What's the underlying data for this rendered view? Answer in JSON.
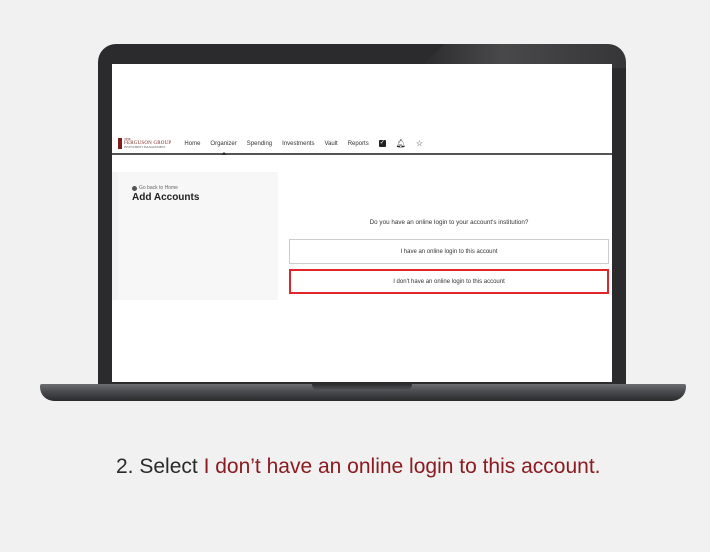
{
  "colors": {
    "page_background": "#f1f1f1",
    "accent": "#8b1b20",
    "highlight_border": "#e0262a",
    "laptop_frame": "#2b2b2d"
  },
  "app": {
    "logo": {
      "line1": "THE",
      "line2": "FERGUSON GROUP",
      "line3": "INVESTMENT MANAGEMENT"
    },
    "nav": {
      "items": [
        {
          "label": "Home"
        },
        {
          "label": "Organizer",
          "active": true
        },
        {
          "label": "Spending"
        },
        {
          "label": "Investments"
        },
        {
          "label": "Vault"
        },
        {
          "label": "Reports"
        }
      ],
      "icons": [
        "checkbox-icon",
        "bell-icon",
        "star-icon"
      ]
    },
    "back_link": "Go back to Home",
    "page_title": "Add Accounts",
    "question": "Do you have an online login to your account's institution?",
    "options": [
      {
        "label": "I have an online login to this account",
        "highlighted": false
      },
      {
        "label": "I don't have an online login to this account",
        "highlighted": true
      }
    ]
  },
  "caption": {
    "step": "2. Select ",
    "action": "I don’t have an online login to this account."
  }
}
